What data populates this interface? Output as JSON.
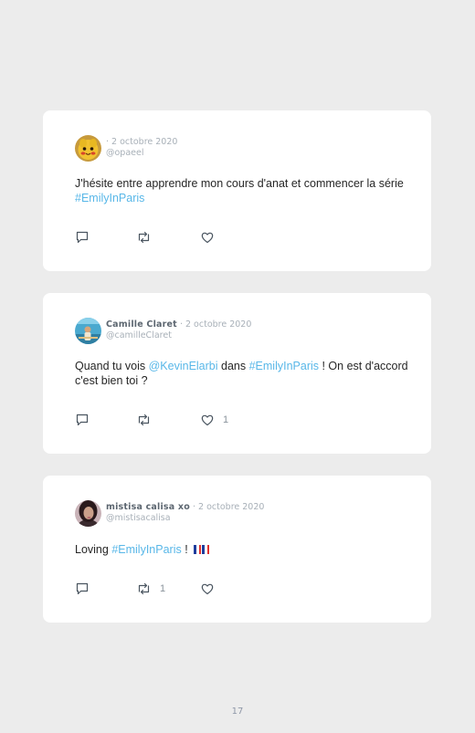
{
  "tweets": [
    {
      "author": "",
      "date": "· 2 octobre 2020",
      "handle": "@opaeel",
      "text_before": "J'hésite entre apprendre mon cours d'anat et commencer la série ",
      "hashtag": "#EmilyInParis",
      "reply_count": "",
      "retweet_count": "",
      "like_count": ""
    },
    {
      "author": "Camille Claret",
      "date": "· 2 octobre 2020",
      "handle": "@camilleClaret",
      "text_before": "Quand tu vois ",
      "mention": "@KevinElarbi",
      "text_middle": " dans ",
      "hashtag": "#EmilyInParis",
      "text_after": " ! On est d'accord c'est bien toi ?",
      "reply_count": "",
      "retweet_count": "",
      "like_count": "1"
    },
    {
      "author": "mistisa calisa xo",
      "date": "· 2 octobre 2020",
      "handle": "@mistisacalisa",
      "text_before": "Loving ",
      "hashtag": "#EmilyInParis",
      "text_after": " ! ",
      "reply_count": "",
      "retweet_count": "1",
      "like_count": ""
    }
  ],
  "icons": {
    "reply": "speech-bubble-icon",
    "retweet": "retweet-arrows-icon",
    "like": "heart-outline-icon",
    "flag": "france-flag-icon"
  },
  "colors": {
    "background": "#ececec",
    "card": "#ffffff",
    "link": "#58b7e8",
    "muted": "#a8b0b8",
    "author": "#5c6670",
    "text": "#262626"
  },
  "page_number": "17"
}
